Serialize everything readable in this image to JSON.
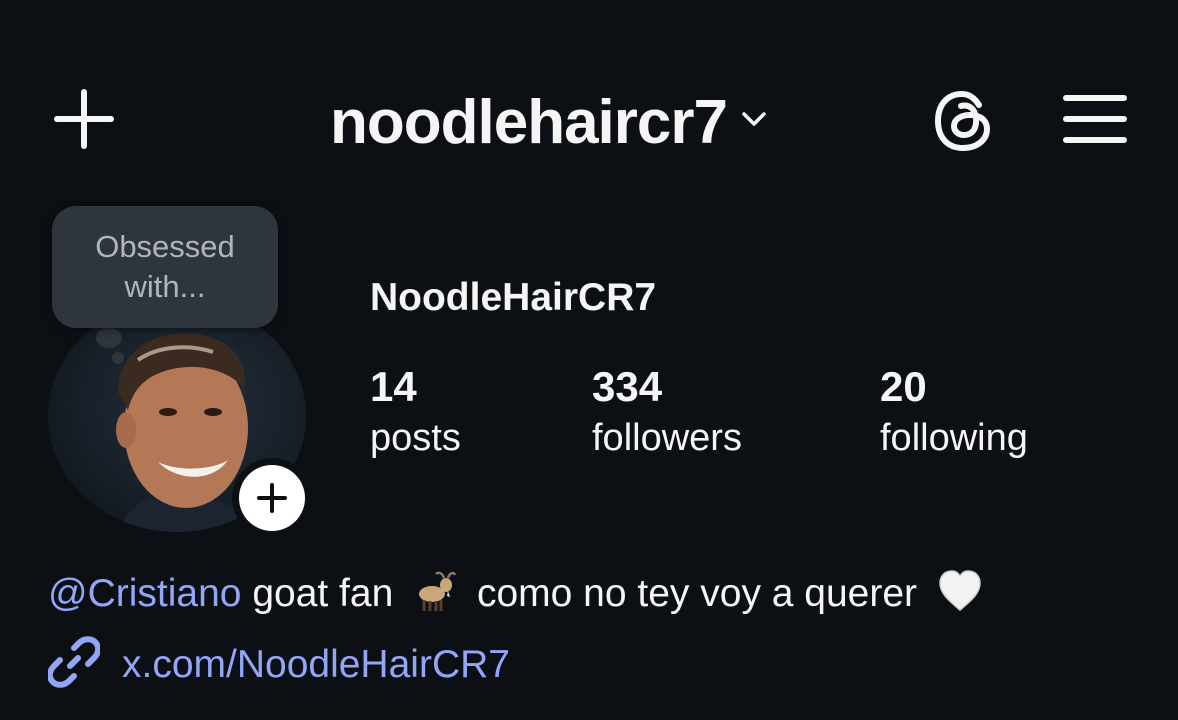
{
  "header": {
    "username": "noodlehaircr7"
  },
  "note": {
    "text": "Obsessed with..."
  },
  "profile": {
    "display_name": "NoodleHairCR7",
    "stats": {
      "posts": {
        "value": "14",
        "label": "posts"
      },
      "followers": {
        "value": "334",
        "label": "followers"
      },
      "following": {
        "value": "20",
        "label": "following"
      }
    },
    "bio": {
      "mention": "@Cristiano",
      "text_a": " goat fan",
      "emoji_1": "goat-emoji",
      "text_b": "como no tey voy a querer",
      "emoji_2": "white-heart-emoji"
    },
    "link": "x.com/NoodleHairCR7"
  },
  "icons": {
    "new_post": "plus-icon",
    "switch": "chevron-down-icon",
    "threads": "threads-icon",
    "menu": "hamburger-menu-icon",
    "add_story": "add-story-icon",
    "link": "link-icon"
  },
  "colors": {
    "background": "#0c1014",
    "text": "#f5f5f5",
    "link": "#93a5f7",
    "note_bubble": "#2f353c"
  }
}
